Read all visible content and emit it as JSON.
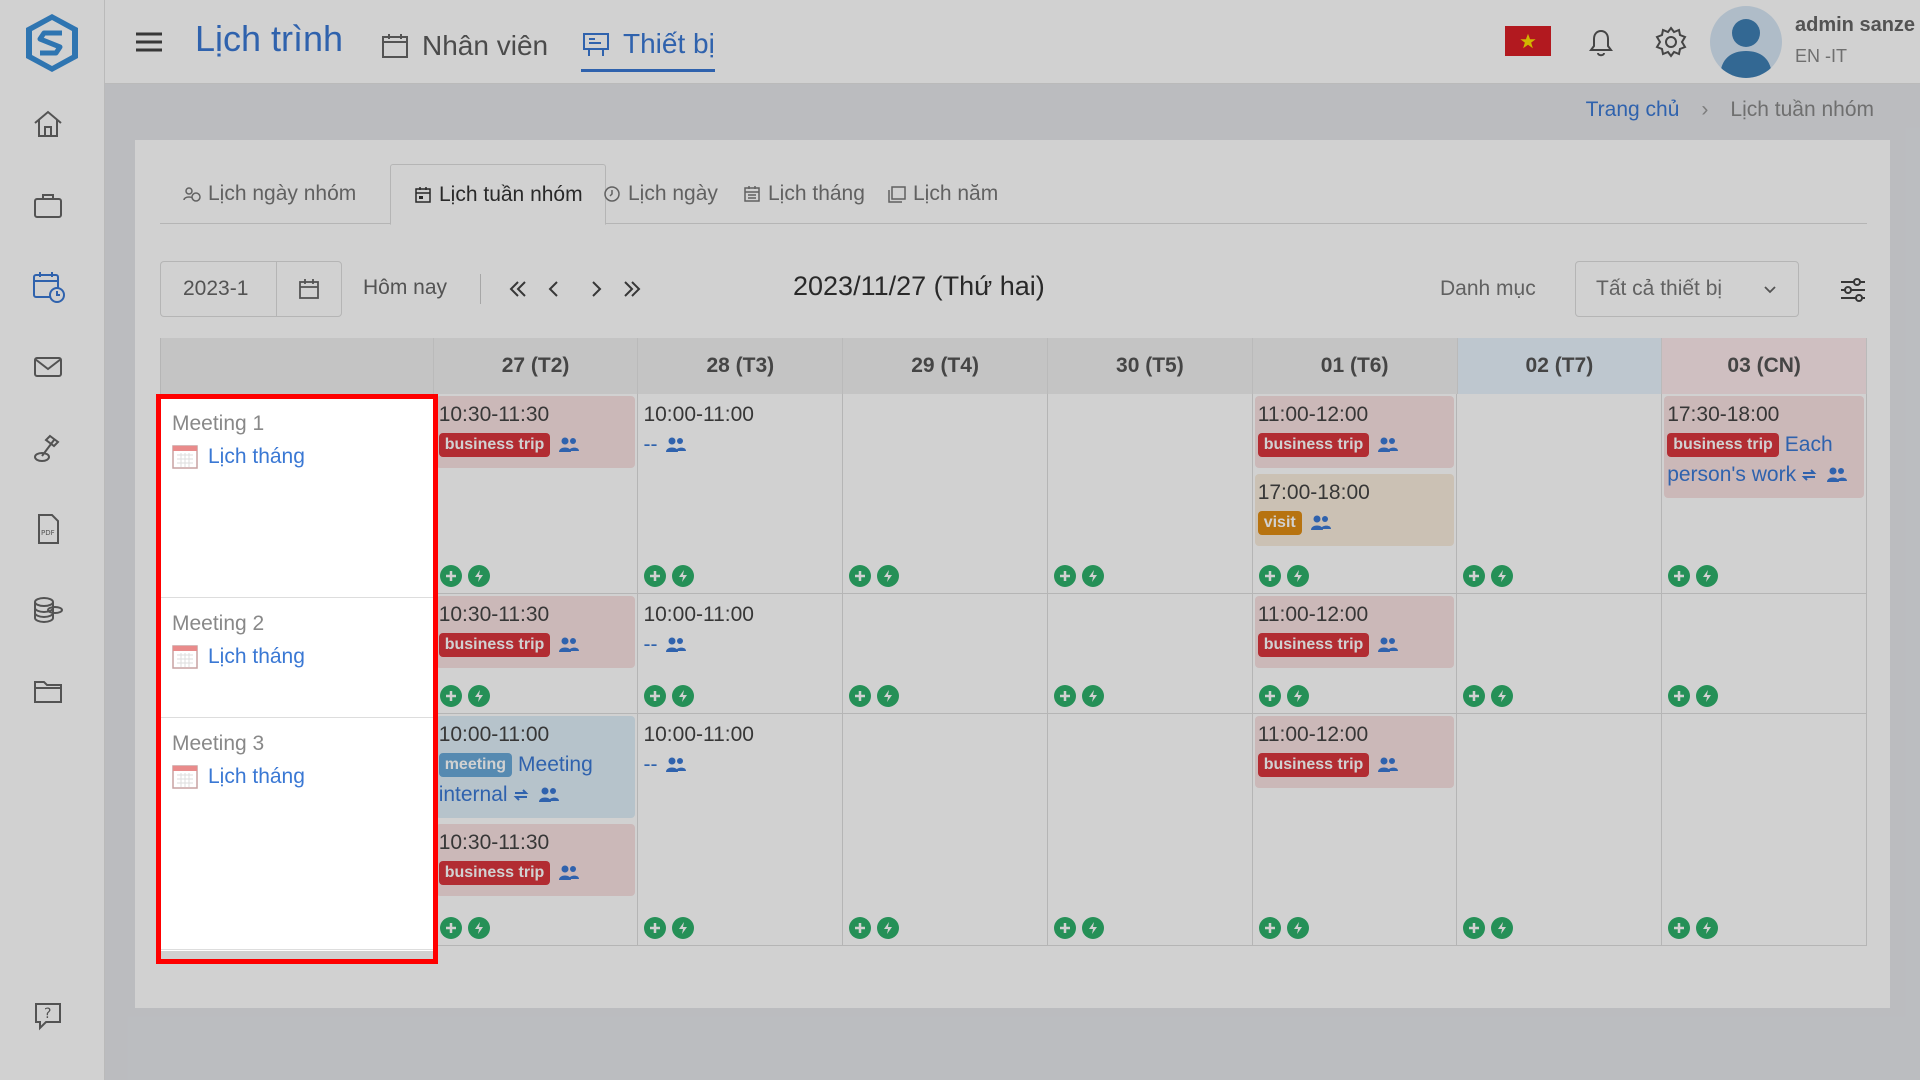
{
  "header": {
    "app_title": "Lịch trình",
    "nav": [
      {
        "label": "Nhân viên"
      },
      {
        "label": "Thiết bị"
      }
    ],
    "user_name": "admin sanze",
    "user_lang": "EN -IT"
  },
  "breadcrumb": {
    "home": "Trang chủ",
    "current": "Lịch tuần nhóm"
  },
  "tabs": [
    {
      "label": "Lịch ngày nhóm"
    },
    {
      "label": "Lịch tuần nhóm"
    },
    {
      "label": "Lịch ngày"
    },
    {
      "label": "Lịch tháng"
    },
    {
      "label": "Lịch năm"
    }
  ],
  "toolbar": {
    "date_value": "2023-1",
    "today_label": "Hôm nay",
    "current_date": "2023/11/27  (Thứ hai)",
    "category_label": "Danh mục",
    "device_select": "Tất cả thiết bị"
  },
  "grid": {
    "days": [
      {
        "label": "27  (T2)"
      },
      {
        "label": "28  (T3)"
      },
      {
        "label": "29  (T4)"
      },
      {
        "label": "30  (T5)"
      },
      {
        "label": "01  (T6)"
      },
      {
        "label": "02  (T7)"
      },
      {
        "label": "03  (CN)"
      }
    ],
    "rows": [
      {
        "name": "Meeting 1",
        "link": "Lịch tháng",
        "cells": [
          [
            {
              "time": "10:30-11:30",
              "badge": "business trip",
              "color": "red"
            }
          ],
          [
            {
              "time": "10:00-11:00",
              "dash": "--"
            }
          ],
          [],
          [],
          [
            {
              "time": "11:00-12:00",
              "badge": "business trip",
              "color": "red"
            },
            {
              "time": "17:00-18:00",
              "badge": "visit",
              "color": "orange"
            }
          ],
          [],
          [
            {
              "time": "17:30-18:00",
              "badge": "business trip",
              "color": "red",
              "note": "Each person's work"
            }
          ]
        ]
      },
      {
        "name": "Meeting 2",
        "link": "Lịch tháng",
        "cells": [
          [
            {
              "time": "10:30-11:30",
              "badge": "business trip",
              "color": "red"
            }
          ],
          [
            {
              "time": "10:00-11:00",
              "dash": "--"
            }
          ],
          [],
          [],
          [
            {
              "time": "11:00-12:00",
              "badge": "business trip",
              "color": "red"
            }
          ],
          [],
          []
        ]
      },
      {
        "name": "Meeting 3",
        "link": "Lịch tháng",
        "cells": [
          [
            {
              "time": "10:00-11:00",
              "badge": "meeting",
              "color": "blue",
              "note": "Meeting internal"
            },
            {
              "time": "10:30-11:30",
              "badge": "business trip",
              "color": "red"
            }
          ],
          [
            {
              "time": "10:00-11:00",
              "dash": "--"
            }
          ],
          [],
          [],
          [
            {
              "time": "11:00-12:00",
              "badge": "business trip",
              "color": "red"
            }
          ],
          [],
          []
        ]
      }
    ]
  },
  "colors": {
    "accent": "#3a78d4",
    "highlight": "#ff0000",
    "action_green": "#2eb06b"
  }
}
